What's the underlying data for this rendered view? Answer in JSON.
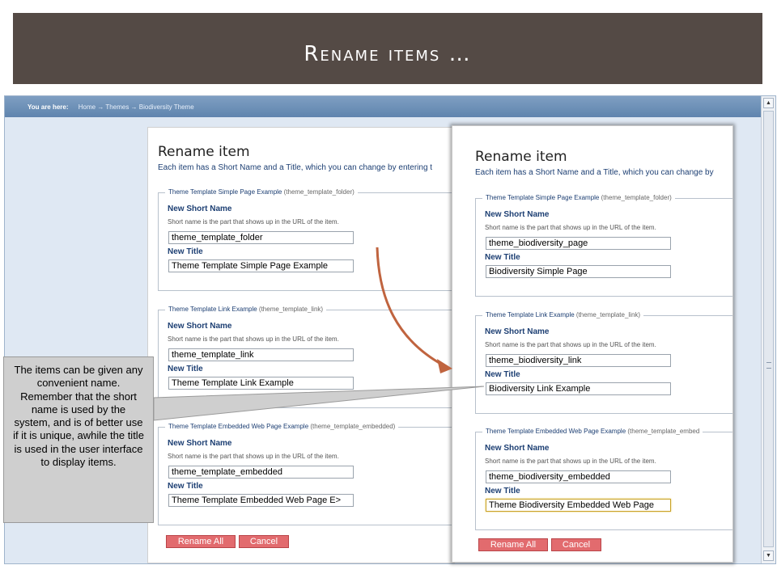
{
  "slide": {
    "title": "Rename items …"
  },
  "browser": {
    "breadcrumb_label": "You are here:",
    "breadcrumb_path": "Home → Themes → Biodiversity Theme",
    "scroll_up": "▲",
    "scroll_down": "▼"
  },
  "left_panel": {
    "heading": "Rename item",
    "description": "Each item has a Short Name and a Title, which you can change by entering t",
    "items": [
      {
        "legend_title": "Theme Template Simple Page Example",
        "legend_id": "(theme_template_folder)",
        "short_name_label": "New Short Name",
        "help": "Short name is the part that shows up in the URL of the item.",
        "short_name_value": "theme_template_folder",
        "title_label": "New Title",
        "title_value": "Theme Template Simple Page Example"
      },
      {
        "legend_title": "Theme Template Link Example",
        "legend_id": "(theme_template_link)",
        "short_name_label": "New Short Name",
        "help": "Short name is the part that shows up in the URL of the item.",
        "short_name_value": "theme_template_link",
        "title_label": "New Title",
        "title_value": "Theme Template Link Example"
      },
      {
        "legend_title": "Theme Template Embedded Web Page Example",
        "legend_id": "(theme_template_embedded)",
        "short_name_label": "New Short Name",
        "help": "Short name is the part that shows up in the URL of the item.",
        "short_name_value": "theme_template_embedded",
        "title_label": "New Title",
        "title_value": "Theme Template Embedded Web Page E>"
      }
    ],
    "rename_all_label": "Rename All",
    "cancel_label": "Cancel"
  },
  "right_panel": {
    "heading": "Rename item",
    "description": "Each item has a Short Name and a Title, which you can change by",
    "items": [
      {
        "legend_title": "Theme Template Simple Page Example",
        "legend_id": "(theme_template_folder)",
        "short_name_label": "New Short Name",
        "help": "Short name is the part that shows up in the URL of the item.",
        "short_name_value": "theme_biodiversity_page",
        "title_label": "New Title",
        "title_value": "Biodiversity Simple Page"
      },
      {
        "legend_title": "Theme Template Link Example",
        "legend_id": "(theme_template_link)",
        "short_name_label": "New Short Name",
        "help": "Short name is the part that shows up in the URL of the item.",
        "short_name_value": "theme_biodiversity_link",
        "title_label": "New Title",
        "title_value": "Biodiversity Link Example"
      },
      {
        "legend_title": "Theme Template Embedded Web Page Example",
        "legend_id": "(theme_template_embed",
        "short_name_label": "New Short Name",
        "help": "Short name is the part that shows up in the URL of the item.",
        "short_name_value": "theme_biodiversity_embedded",
        "title_label": "New Title",
        "title_value": "Theme Biodiversity Embedded Web Page"
      }
    ],
    "rename_all_label": "Rename All",
    "cancel_label": "Cancel"
  },
  "callout": {
    "text": "The items can be given any convenient name. Remember that the short name is used by the system, and is of better use if it is unique, awhile the title is used in the user interface to display items."
  },
  "colors": {
    "title_bar": "#544a45",
    "arrow": "#c0643f",
    "button": "#e26b6e",
    "label_blue": "#1d3f73"
  }
}
